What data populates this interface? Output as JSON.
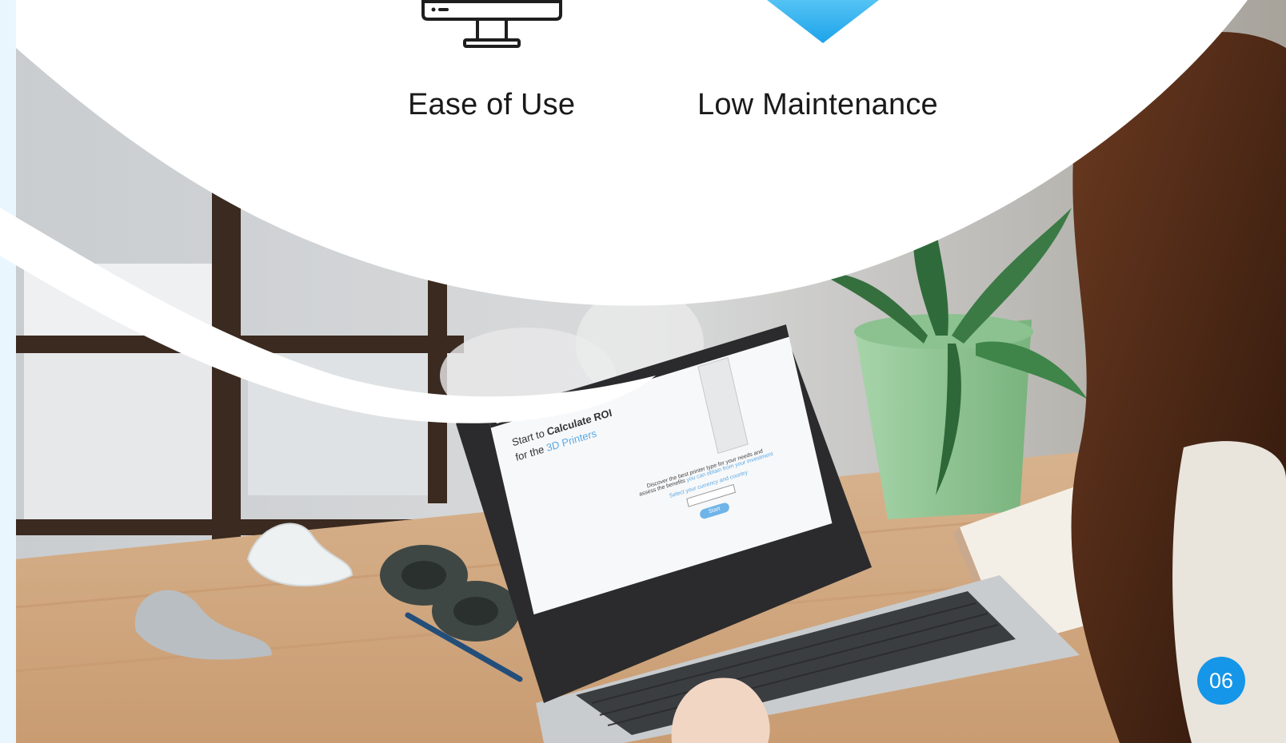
{
  "features": [
    {
      "label": "Ease of Use",
      "icon": "monitor-icon"
    },
    {
      "label": "Low Maintenance",
      "icon": "blue-triangle-icon"
    }
  ],
  "page_number": "06",
  "laptop_screen": {
    "headline_line1_prefix": "Start to ",
    "headline_line1_bold": "Calculate ROI",
    "headline_line2_prefix": "for the ",
    "headline_line2_accent": "3D Printers",
    "body_line1": "Discover the best printer type for your needs and",
    "body_line2_prefix": "assess the benefits ",
    "body_line2_accent": "you can obtain from your investment",
    "select_prompt": "Select your currency and country",
    "start_button": "Start"
  },
  "colors": {
    "accent": "#1596e8",
    "triangle": "#2fb2f0",
    "background": "#ffffff",
    "left_strip": "#eaf6fd"
  }
}
